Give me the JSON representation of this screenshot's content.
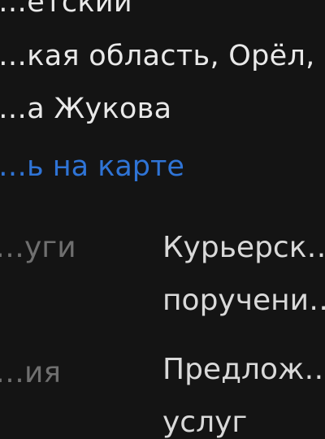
{
  "address": {
    "district": "…етский",
    "region_city": "…кая область, Орёл,",
    "street": "…а Жукова"
  },
  "map_link": "…ь на карте",
  "details": [
    {
      "label": "…уги",
      "value_lines": [
        "Курьерск…",
        "поручени…"
      ]
    },
    {
      "label": "…ия",
      "value_lines": [
        "Предлож…",
        "услуг"
      ]
    }
  ],
  "colors": {
    "background": "#141414",
    "text": "#e9e9e9",
    "muted": "#6f6f6f",
    "link": "#2f74d6"
  }
}
